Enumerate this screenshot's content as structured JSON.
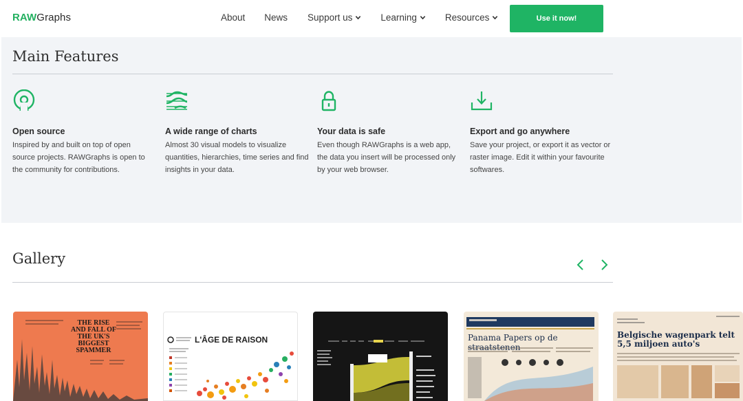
{
  "brand": {
    "logo_raw": "RAW",
    "logo_graphs": "Graphs",
    "accent": "#1fb464"
  },
  "nav": {
    "about": "About",
    "news": "News",
    "support": "Support us",
    "learning": "Learning",
    "resources": "Resources",
    "cta": "Use it now!"
  },
  "features": {
    "title": "Main Features",
    "items": [
      {
        "icon": "open-source-icon",
        "title": "Open source",
        "desc": "Inspired by and built on top of open source projects. RAWGraphs is open to the community for contributions."
      },
      {
        "icon": "charts-range-icon",
        "title": "A wide range of charts",
        "desc": "Almost 30 visual models to visualize quantities, hierarchies, time series and find insights in your data."
      },
      {
        "icon": "lock-icon",
        "title": "Your data is safe",
        "desc": "Even though RAWGraphs is a web app, the data you insert will be processed only by your web browser."
      },
      {
        "icon": "download-icon",
        "title": "Export and go anywhere",
        "desc": "Save your project, or export it as vector or raster image. Edit it within your favourite softwares."
      }
    ]
  },
  "gallery": {
    "title": "Gallery",
    "cards": [
      {
        "text": "THE RISE AND FALL OF THE UK'S BIGGEST SPAMMER",
        "bg": "#ee7a4f"
      },
      {
        "text": "L'ÂGE DE RAISON",
        "bg": "#ffffff"
      },
      {
        "text": "",
        "bg": "#151515"
      },
      {
        "text": "Panama Papers op de straatstenen",
        "bg": "#f3e9d9"
      },
      {
        "text": "Belgische wagenpark telt 5,5 miljoen auto's",
        "bg": "#f2e6d6"
      }
    ]
  }
}
